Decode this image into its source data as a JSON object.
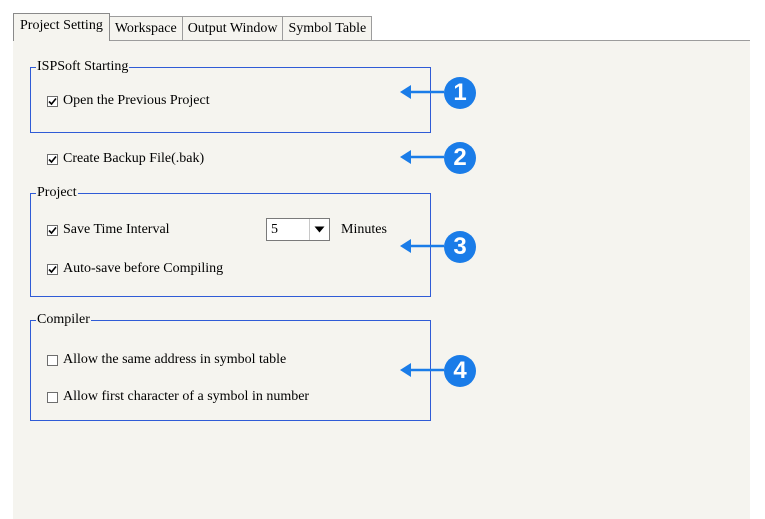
{
  "tabs": [
    {
      "label": "Project Setting",
      "active": true
    },
    {
      "label": "Workspace",
      "active": false
    },
    {
      "label": "Output Window",
      "active": false
    },
    {
      "label": "Symbol Table",
      "active": false
    }
  ],
  "groups": {
    "startup": {
      "title": "ISPSoft Starting",
      "open_previous": {
        "label": "Open the Previous Project",
        "checked": true
      }
    },
    "backup": {
      "label": "Create Backup File(.bak)",
      "checked": true
    },
    "project": {
      "title": "Project",
      "save_interval": {
        "label": "Save Time Interval",
        "checked": true
      },
      "interval_value": "5",
      "interval_unit": "Minutes",
      "auto_save": {
        "label": "Auto-save before Compiling",
        "checked": true
      }
    },
    "compiler": {
      "title": "Compiler",
      "same_address": {
        "label": "Allow the same address in symbol table",
        "checked": false
      },
      "first_char_number": {
        "label": "Allow first character of a symbol in number",
        "checked": false
      }
    }
  },
  "callouts": [
    "1",
    "2",
    "3",
    "4"
  ],
  "colors": {
    "accent": "#1a7ce8",
    "group_border": "#2f5bd6",
    "panel_bg": "#f5f4ef"
  }
}
